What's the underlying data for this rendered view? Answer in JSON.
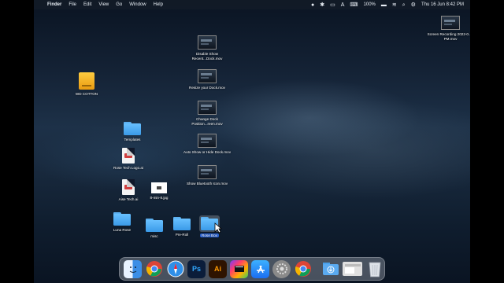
{
  "menubar": {
    "apple": "",
    "app": "Finder",
    "menus": [
      "File",
      "Edit",
      "View",
      "Go",
      "Window",
      "Help"
    ],
    "battery": "100%",
    "datetime": "Thu 16 Jun  8:42 PM"
  },
  "desktop": {
    "items": [
      {
        "label": "WD COTTON",
        "kind": "drive-icon"
      },
      {
        "label": "Templates",
        "kind": "folder-icon"
      },
      {
        "label": "Rose Tech Logo.ai",
        "kind": "document-icon"
      },
      {
        "label": "Aise Tech.ai",
        "kind": "document-icon"
      },
      {
        "label": "8-min-8.jpg",
        "kind": "image-icon"
      },
      {
        "label": "Luna Rose",
        "kind": "folder-icon"
      },
      {
        "label": "misc",
        "kind": "folder-icon"
      },
      {
        "label": "Pre-Roll",
        "kind": "folder-icon"
      },
      {
        "label": "Rose Box",
        "kind": "folder-icon",
        "selected": true
      },
      {
        "label": "Disable Show Recent...Dock.mov",
        "kind": "movie-icon"
      },
      {
        "label": "Resize your Dock.mov",
        "kind": "movie-icon"
      },
      {
        "label": "Change Dock Position...reen.mov",
        "kind": "movie-icon"
      },
      {
        "label": "Auto Show or Hide Dock.mov",
        "kind": "movie-icon"
      },
      {
        "label": "Show Bluetooth Icon.mov",
        "kind": "movie-icon"
      },
      {
        "label": "Screen Recording 2022-0...7 PM.mov",
        "kind": "movie-icon"
      }
    ]
  },
  "dock": {
    "apps": [
      {
        "name": "Finder",
        "icon": "finder-icon",
        "glyph": "",
        "color": "#3a8ee6"
      },
      {
        "name": "Chrome",
        "icon": "chrome-icon",
        "glyph": "",
        "color": "#e8e8e8"
      },
      {
        "name": "Safari",
        "icon": "safari-icon",
        "glyph": "",
        "color": "#2f8fe8"
      },
      {
        "name": "Photoshop",
        "icon": "photoshop-icon",
        "glyph": "Ps",
        "color": "#0b1d3a"
      },
      {
        "name": "Illustrator",
        "icon": "illustrator-icon",
        "glyph": "Ai",
        "color": "#2e1300"
      },
      {
        "name": "Final Cut Pro",
        "icon": "final-cut-icon",
        "glyph": "",
        "color": "#1a1a1a"
      },
      {
        "name": "App Store",
        "icon": "app-store-icon",
        "glyph": "",
        "color": "#1b7cf0"
      },
      {
        "name": "System Preferences",
        "icon": "system-preferences-icon",
        "glyph": "",
        "color": "#8a8a8a"
      },
      {
        "name": "Chrome Canary",
        "icon": "chrome-canary-icon",
        "glyph": "",
        "color": "#e8e8e8"
      },
      {
        "name": "Downloads",
        "icon": "downloads-folder-icon",
        "glyph": "",
        "color": "#5aaaf0"
      },
      {
        "name": "Recent",
        "icon": "recent-window-icon",
        "glyph": "",
        "color": "#d8d8d8"
      },
      {
        "name": "Trash",
        "icon": "trash-icon",
        "glyph": "",
        "color": "#cfd4da"
      }
    ]
  }
}
